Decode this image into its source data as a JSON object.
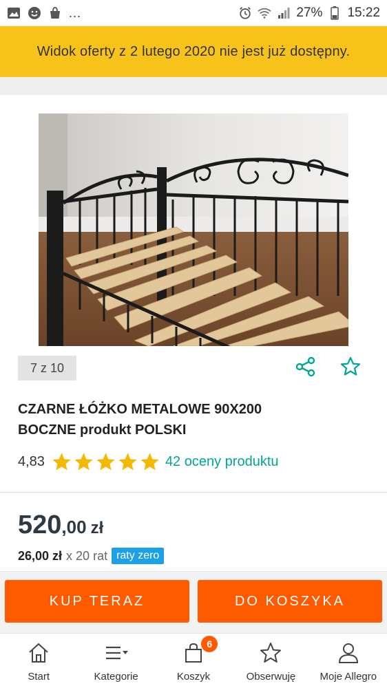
{
  "status_bar": {
    "overflow": "...",
    "battery": "27%",
    "time": "15:22",
    "icons": [
      "gallery-icon",
      "smiley-icon",
      "shopping-bag-icon",
      "alarm-icon",
      "wifi-icon",
      "signal-icon",
      "battery-icon"
    ]
  },
  "notice": {
    "text": "Widok oferty z 2 lutego 2020 nie jest już dostępny."
  },
  "gallery": {
    "counter": "7 z 10",
    "image_alt": "product-photo-metal-daybed"
  },
  "product": {
    "title_line1": "CZARNE ŁÓŻKO METALOWE 90X200",
    "title_line2": "BOCZNE produkt POLSKI"
  },
  "rating": {
    "value": "4,83",
    "stars": 5,
    "count_label": "42 oceny produktu",
    "star_color": "#f5b800"
  },
  "price": {
    "integer": "520",
    "decimal": ",00",
    "currency": "zł",
    "installment_amount": "26,00 zł",
    "installment_multiplier": "x 20 rat",
    "installment_badge": "raty zero"
  },
  "actions": {
    "buy_now": "KUP TERAZ",
    "add_to_cart": "DO KOSZYKA",
    "accent_color": "#ff5a00"
  },
  "bottom_nav": {
    "items": [
      {
        "label": "Start",
        "icon": "home-icon"
      },
      {
        "label": "Kategorie",
        "icon": "menu-icon"
      },
      {
        "label": "Koszyk",
        "icon": "cart-icon",
        "badge": "6"
      },
      {
        "label": "Obserwuję",
        "icon": "star-icon"
      },
      {
        "label": "Moje Allegro",
        "icon": "user-icon"
      }
    ]
  }
}
